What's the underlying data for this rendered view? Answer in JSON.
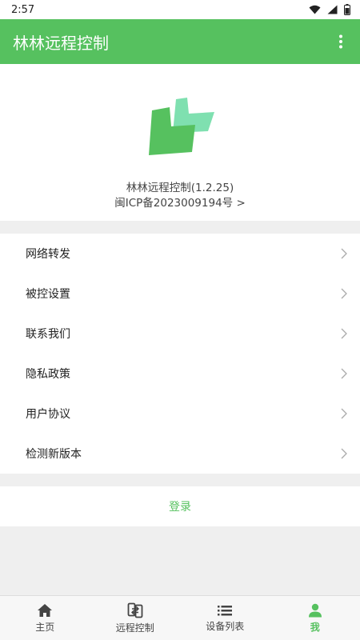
{
  "status_bar": {
    "time": "2:57",
    "icons": [
      "wifi-icon",
      "signal-icon",
      "battery-icon"
    ]
  },
  "app_bar": {
    "title": "林林远程控制",
    "menu_icon": "more-vertical-icon"
  },
  "header": {
    "version": "林林远程控制(1.2.25)",
    "icp": "闽ICP备2023009194号 >"
  },
  "menu": {
    "items": [
      {
        "label": "网络转发"
      },
      {
        "label": "被控设置"
      },
      {
        "label": "联系我们"
      },
      {
        "label": "隐私政策"
      },
      {
        "label": "用户协议"
      },
      {
        "label": "检测新版本"
      }
    ],
    "chevron_icon": "chevron-right-icon"
  },
  "login": {
    "label": "登录"
  },
  "bottom_nav": {
    "items": [
      {
        "label": "主页",
        "icon": "home-icon"
      },
      {
        "label": "远程控制",
        "icon": "remote-control-icon"
      },
      {
        "label": "设备列表",
        "icon": "list-icon"
      },
      {
        "label": "我",
        "icon": "person-icon"
      }
    ],
    "active": "我"
  },
  "colors": {
    "accent": "#56c15f",
    "logo_dark": "#56c15f",
    "logo_light": "#7fe0b0",
    "background": "#efefef"
  }
}
